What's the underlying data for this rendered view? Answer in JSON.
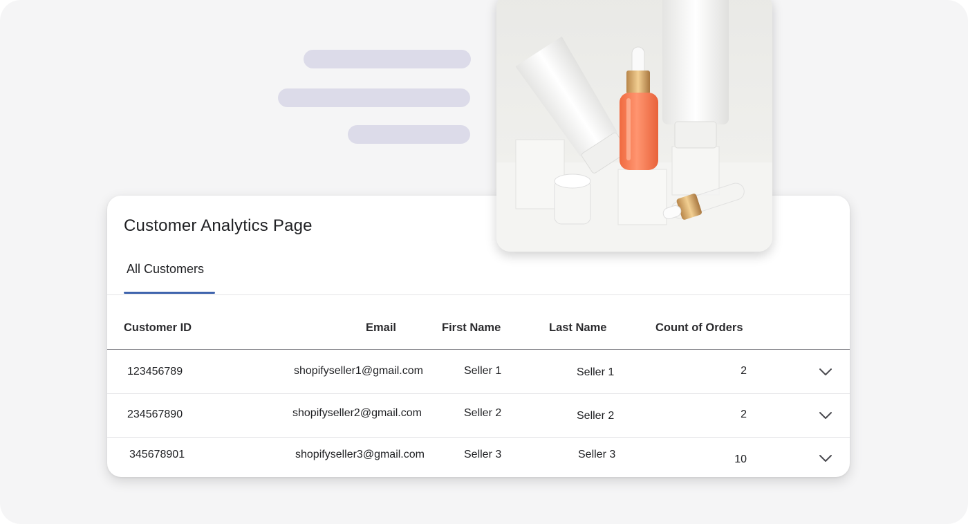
{
  "card": {
    "title": "Customer Analytics Page",
    "tab_label": "All Customers"
  },
  "table": {
    "headers": {
      "customer_id": "Customer ID",
      "email": "Email",
      "first_name": "First Name",
      "last_name": "Last Name",
      "count_of_orders": "Count of Orders"
    },
    "rows": [
      {
        "customer_id": "123456789",
        "email": "shopifyseller1@gmail.com",
        "first_name": "Seller 1",
        "last_name": "Seller 1",
        "count_of_orders": "2"
      },
      {
        "customer_id": "234567890",
        "email": "shopifyseller2@gmail.com",
        "first_name": "Seller 2",
        "last_name": "Seller 2",
        "count_of_orders": "2"
      },
      {
        "customer_id": "345678901",
        "email": "shopifyseller3@gmail.com",
        "first_name": "Seller 3",
        "last_name": "Seller 3",
        "count_of_orders": "10"
      }
    ]
  },
  "icons": {
    "row_toggle": "chevron-down-icon",
    "product_photo": "cosmetics-product-photo"
  },
  "colors": {
    "background": "#f5f5f6",
    "placeholder_lines": "#dcdbe9",
    "tab_underline": "#3f64ad",
    "serum_orange": "#f6794f"
  }
}
